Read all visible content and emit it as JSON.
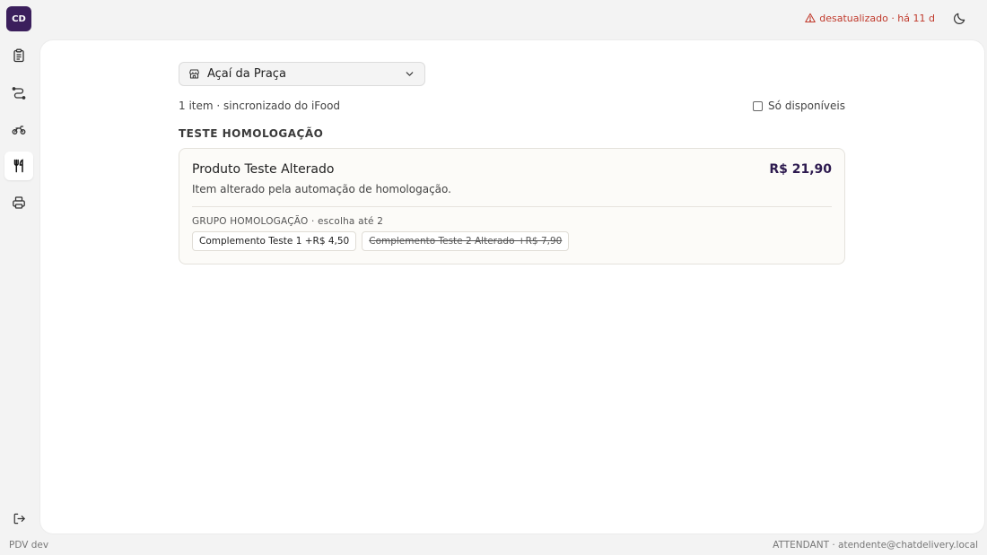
{
  "app": {
    "logo_text": "CD",
    "env_label": "PDV dev",
    "user_label": "ATTENDANT · atendente@chatdelivery.local"
  },
  "status": {
    "text": "desatualizado · há 11 d",
    "color": "#c0392b"
  },
  "sidebar": {
    "items": [
      {
        "icon": "clipboard-icon",
        "active": false
      },
      {
        "icon": "route-icon",
        "active": false
      },
      {
        "icon": "motorcycle-icon",
        "active": false
      },
      {
        "icon": "utensils-icon",
        "active": true
      },
      {
        "icon": "printer-icon",
        "active": false
      }
    ]
  },
  "store_selector": {
    "selected": "Açaí da Praça"
  },
  "menu": {
    "summary": "1 item · sincronizado do iFood",
    "filter_label": "Só disponíveis",
    "filter_checked": false,
    "section_title": "TESTE HOMOLOGAÇÃO",
    "product": {
      "name": "Produto Teste Alterado",
      "price": "R$ 21,90",
      "description": "Item alterado pela automação de homologação.",
      "group_label": "GRUPO HOMOLOGAÇÃO · escolha até 2",
      "options": [
        {
          "label": "Complemento Teste 1 +R$ 4,50",
          "available": true
        },
        {
          "label": "Complemento Teste 2 Alterado +R$ 7,90",
          "available": false
        }
      ]
    }
  },
  "colors": {
    "brand": "#3b1f5c",
    "price": "#2d1a4f"
  }
}
